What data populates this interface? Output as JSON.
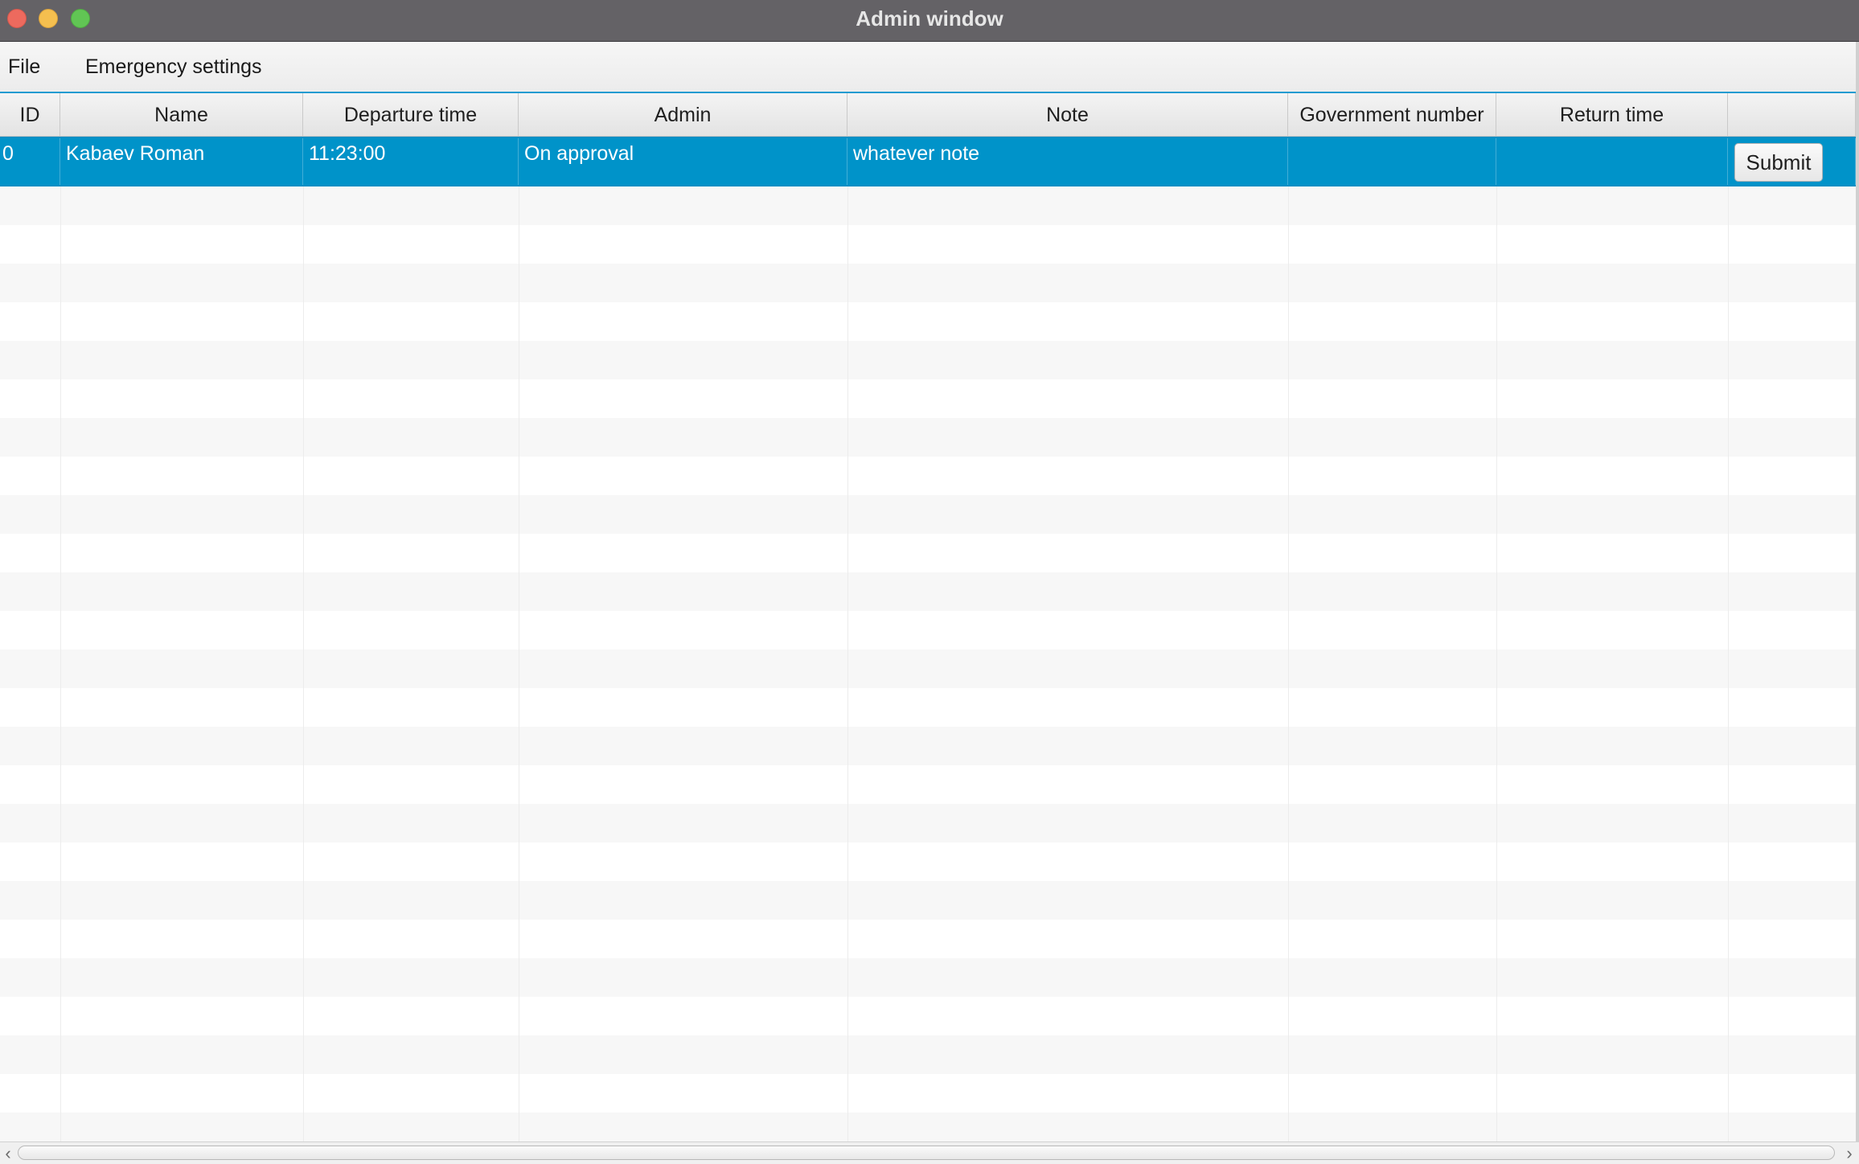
{
  "window": {
    "title": "Admin window"
  },
  "menubar": {
    "items": [
      {
        "label": "File"
      },
      {
        "label": "Emergency settings"
      }
    ]
  },
  "table": {
    "columns": [
      {
        "label": "ID"
      },
      {
        "label": "Name"
      },
      {
        "label": "Departure time"
      },
      {
        "label": "Admin"
      },
      {
        "label": "Note"
      },
      {
        "label": "Government number"
      },
      {
        "label": "Return time"
      },
      {
        "label": ""
      }
    ],
    "rows": [
      {
        "id": "0",
        "name": "Kabaev Roman",
        "departure_time": "11:23:00",
        "admin": "On approval",
        "note": "whatever note",
        "government_number": "",
        "return_time": "",
        "action_label": "Submit",
        "selected": true
      }
    ],
    "selection_color": "#0093c9"
  },
  "scrollbar": {
    "left_arrow": "‹",
    "right_arrow": "›"
  }
}
